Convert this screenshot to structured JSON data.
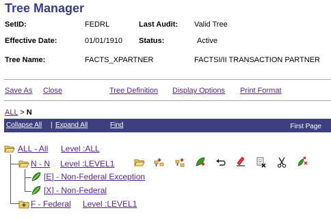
{
  "header": {
    "title": "Tree Manager"
  },
  "info": {
    "setid_label": "SetID:",
    "setid_value": "FEDRL",
    "last_audit_label": "Last Audit:",
    "last_audit_value": "Valid Tree",
    "effective_date_label": "Effective Date:",
    "effective_date_value": "01/01/1910",
    "status_label": "Status:",
    "status_value": "Active",
    "tree_name_label": "Tree Name:",
    "tree_name_value": "FACTS_XPARTNER",
    "tree_desc_value": "FACTSI/II TRANSACTION PARTNER"
  },
  "actions": {
    "save_as": "Save As",
    "close": "Close",
    "tree_definition": "Tree Definition",
    "display_options": "Display Options",
    "print_format": "Print Format"
  },
  "breadcrumb": {
    "root": "ALL",
    "separator": ">",
    "current": "N"
  },
  "navbar": {
    "collapse_all": "Collapse All",
    "divider": "|",
    "expand_all": "Expand All",
    "find": "Find",
    "page": "First Page"
  },
  "tree": {
    "root": {
      "name": "ALL - All",
      "level": "Level :ALL"
    },
    "n_node": {
      "name": "N - N",
      "level": "Level :LEVEL1"
    },
    "leaf_e": "[E] - Non-Federal Exception",
    "leaf_x": "[X] - Non-Federal",
    "f_node": {
      "name": "F - Federal",
      "level": "Level :LEVEL1"
    }
  },
  "icons": [
    "open-folder-icon",
    "insert-sibling-icon",
    "insert-child-icon",
    "insert-detail-icon",
    "undo-icon",
    "edit-icon",
    "delete-icon",
    "cut-icon",
    "paste-icon"
  ],
  "colors": {
    "title": "#3c3c8a",
    "link": "#5a1f96",
    "navbar": "#3d3f7e",
    "leaf_green": "#3a9a22",
    "folder": "#d9b84a"
  }
}
